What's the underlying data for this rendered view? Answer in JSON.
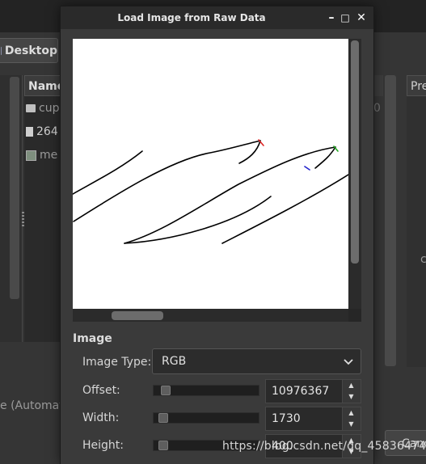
{
  "background": {
    "desktop_label": "Desktop",
    "list_header": "Name",
    "rows": [
      "cup",
      "264",
      "me"
    ],
    "preview_label": "Pre",
    "automation_text": "e (Automatio",
    "cancel_label": "Canc",
    "faded_zero": "0",
    "faded_c": "c"
  },
  "dialog": {
    "title": "Load Image from Raw Data",
    "minimize_icon": "–",
    "maximize_icon": "□",
    "close_icon": "✕",
    "section_title": "Image",
    "image_type": {
      "label": "Image Type:",
      "value": "RGB"
    },
    "offset": {
      "label": "Offset:",
      "value": "10976367",
      "slider_fraction": 0.03
    },
    "width": {
      "label": "Width:",
      "value": "1730",
      "slider_fraction": 0.0
    },
    "height": {
      "label": "Height:",
      "value": "400",
      "slider_fraction": 0.0
    }
  },
  "watermark": "https://blog.csdn.net/qq_45836474",
  "colors": {
    "dialog_bg": "#3a3a3a",
    "titlebar_bg": "#2a2a2a",
    "preview_bg": "#ffffff",
    "stroke": "#000000"
  }
}
